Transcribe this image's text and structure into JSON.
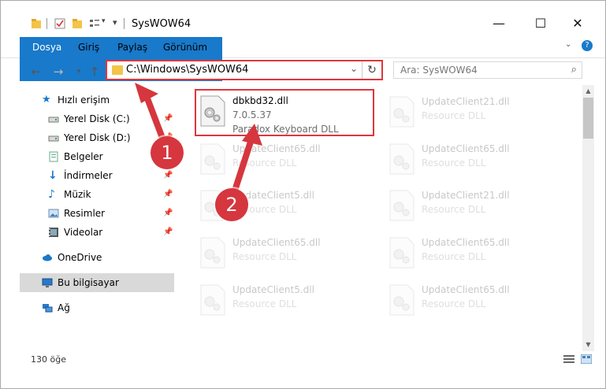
{
  "window": {
    "title": "SysWOW64"
  },
  "ribbon": {
    "tabs": [
      "Dosya",
      "Giriş",
      "Paylaş",
      "Görünüm"
    ]
  },
  "address": {
    "path": "C:\\Windows\\SysWOW64"
  },
  "search": {
    "placeholder": "Ara: SysWOW64"
  },
  "sidebar": {
    "items": [
      {
        "label": "Hızlı erişim",
        "icon": "star-icon"
      },
      {
        "label": "Yerel Disk (C:)",
        "icon": "drive-icon"
      },
      {
        "label": "Yerel Disk (D:)",
        "icon": "drive-icon"
      },
      {
        "label": "Belgeler",
        "icon": "documents-icon"
      },
      {
        "label": "İndirmeler",
        "icon": "download-icon"
      },
      {
        "label": "Müzik",
        "icon": "music-icon"
      },
      {
        "label": "Resimler",
        "icon": "pictures-icon"
      },
      {
        "label": "Videolar",
        "icon": "video-icon"
      },
      {
        "label": "OneDrive",
        "icon": "cloud-icon"
      },
      {
        "label": "Bu bilgisayar",
        "icon": "computer-icon"
      },
      {
        "label": "Ağ",
        "icon": "network-icon"
      }
    ]
  },
  "files": {
    "highlighted": {
      "name": "dbkbd32.dll",
      "version": "7.0.5.37",
      "desc": "Paradox Keyboard DLL"
    },
    "col1": [
      {
        "name": "UpdateClient65.dll",
        "desc": "Resource DLL"
      },
      {
        "name": "UpdateClient5.dll",
        "desc": "Resource DLL"
      },
      {
        "name": "UpdateClient65.dll",
        "desc": "Resource DLL"
      },
      {
        "name": "UpdateClient5.dll",
        "desc": "Resource DLL"
      }
    ],
    "col2": [
      {
        "name": "UpdateClient21.dll",
        "desc": "Resource DLL"
      },
      {
        "name": "UpdateClient65.dll",
        "desc": "Resource DLL"
      },
      {
        "name": "UpdateClient21.dll",
        "desc": "Resource DLL"
      },
      {
        "name": "UpdateClient65.dll",
        "desc": "Resource DLL"
      },
      {
        "name": "UpdateClient65.dll",
        "desc": "Resource DLL"
      }
    ]
  },
  "status": {
    "count": "130 öğe"
  },
  "callouts": [
    "1",
    "2"
  ],
  "colors": {
    "accent": "#1979ca",
    "callout": "#d6363e",
    "highlight": "#e0353d"
  }
}
